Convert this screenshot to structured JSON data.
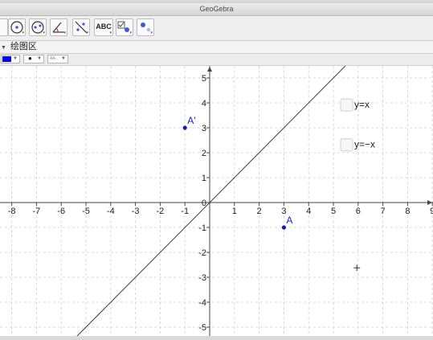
{
  "window": {
    "title": "GeoGebra"
  },
  "toolbar": {
    "tools": [
      {
        "name": "circle-with-center-tool"
      },
      {
        "name": "ellipse-tool"
      },
      {
        "name": "angle-tool"
      },
      {
        "name": "reflect-about-line-tool"
      },
      {
        "name": "text-tool",
        "label": "ABC"
      },
      {
        "name": "checkbox-tool"
      },
      {
        "name": "move-graphics-view-tool"
      }
    ]
  },
  "view_header": {
    "title": "绘图区"
  },
  "style_bar": {
    "color": "#0000ff",
    "point_style": "●",
    "label_style": "AA"
  },
  "graphics": {
    "x_ticks": [
      "-8",
      "-7",
      "-6",
      "-5",
      "-4",
      "-3",
      "-2",
      "-1",
      "0",
      "1",
      "2",
      "3",
      "4",
      "5",
      "6",
      "7",
      "8",
      "9"
    ],
    "y_ticks": [
      "5",
      "4",
      "3",
      "2",
      "1",
      "0",
      "-1",
      "-2",
      "-3",
      "-4",
      "-5"
    ],
    "points": [
      {
        "label": "A",
        "x": 3,
        "y": -1,
        "color": "#1a1ab4"
      },
      {
        "label": "A'",
        "x": -1,
        "y": 3,
        "color": "#1a1ab4"
      }
    ],
    "line": {
      "equation": "y = x"
    },
    "checkboxes": [
      {
        "label": "y=x",
        "checked": false
      },
      {
        "label": "y=−x",
        "checked": false
      }
    ],
    "cursor": "crosshair"
  }
}
